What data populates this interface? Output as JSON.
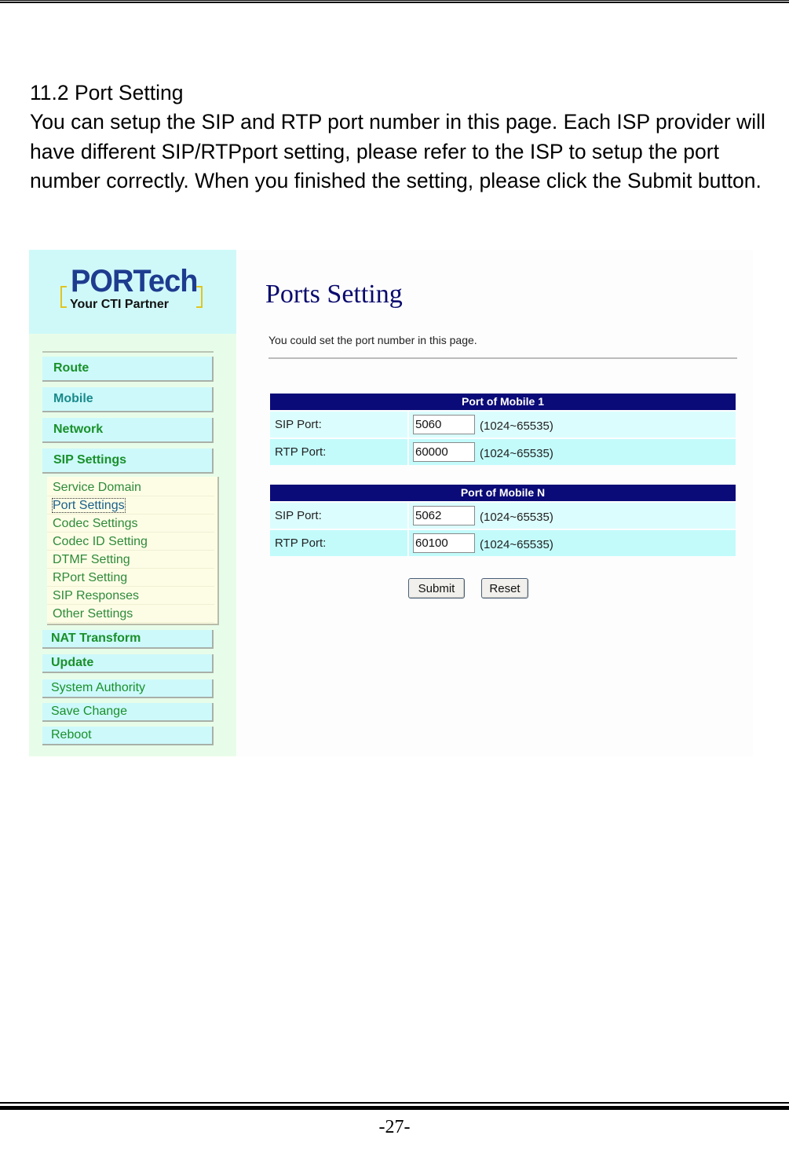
{
  "document": {
    "heading": "11.2 Port Setting",
    "paragraph": "You can setup the SIP and RTP port number in this page. Each ISP provider will have different SIP/RTPport setting, please refer to the ISP to setup the port number correctly. When you finished the setting, please click the Submit button.",
    "page_number": "-27-"
  },
  "screenshot": {
    "logo": {
      "brand": "PORTech",
      "tagline": "Your CTI Partner"
    },
    "sidebar": {
      "main_items": [
        {
          "label": "Route"
        },
        {
          "label": "Mobile"
        },
        {
          "label": "Network"
        },
        {
          "label": "SIP Settings"
        }
      ],
      "sip_submenu": [
        {
          "label": "Service Domain"
        },
        {
          "label": "Port Settings",
          "active": true
        },
        {
          "label": "Codec Settings"
        },
        {
          "label": "Codec ID Setting"
        },
        {
          "label": "DTMF Setting"
        },
        {
          "label": "RPort Setting"
        },
        {
          "label": "SIP Responses"
        },
        {
          "label": "Other Settings"
        }
      ],
      "lower_items": [
        {
          "label": "NAT Transform"
        },
        {
          "label": "Update"
        },
        {
          "label": "System Authority"
        },
        {
          "label": "Save Change"
        },
        {
          "label": "Reboot"
        }
      ]
    },
    "main": {
      "title": "Ports Setting",
      "description": "You could set the port number in this page.",
      "tables": [
        {
          "header": "Port of Mobile 1",
          "rows": [
            {
              "label": "SIP Port:",
              "value": "5060",
              "range": "(1024~65535)"
            },
            {
              "label": "RTP Port:",
              "value": "60000",
              "range": "(1024~65535)"
            }
          ]
        },
        {
          "header": "Port of Mobile N",
          "rows": [
            {
              "label": "SIP Port:",
              "value": "5062",
              "range": "(1024~65535)"
            },
            {
              "label": "RTP Port:",
              "value": "60100",
              "range": "(1024~65535)"
            }
          ]
        }
      ],
      "submit_label": "Submit",
      "reset_label": "Reset"
    },
    "colors": {
      "table_header": "#0a0a78",
      "page_title": "#0a0a6e",
      "nav_text": "#19902a",
      "nav_bg": "#cdf9fb",
      "sidebar_bg": "#e8fde9",
      "submenu_bg": "#fdfde6"
    }
  }
}
